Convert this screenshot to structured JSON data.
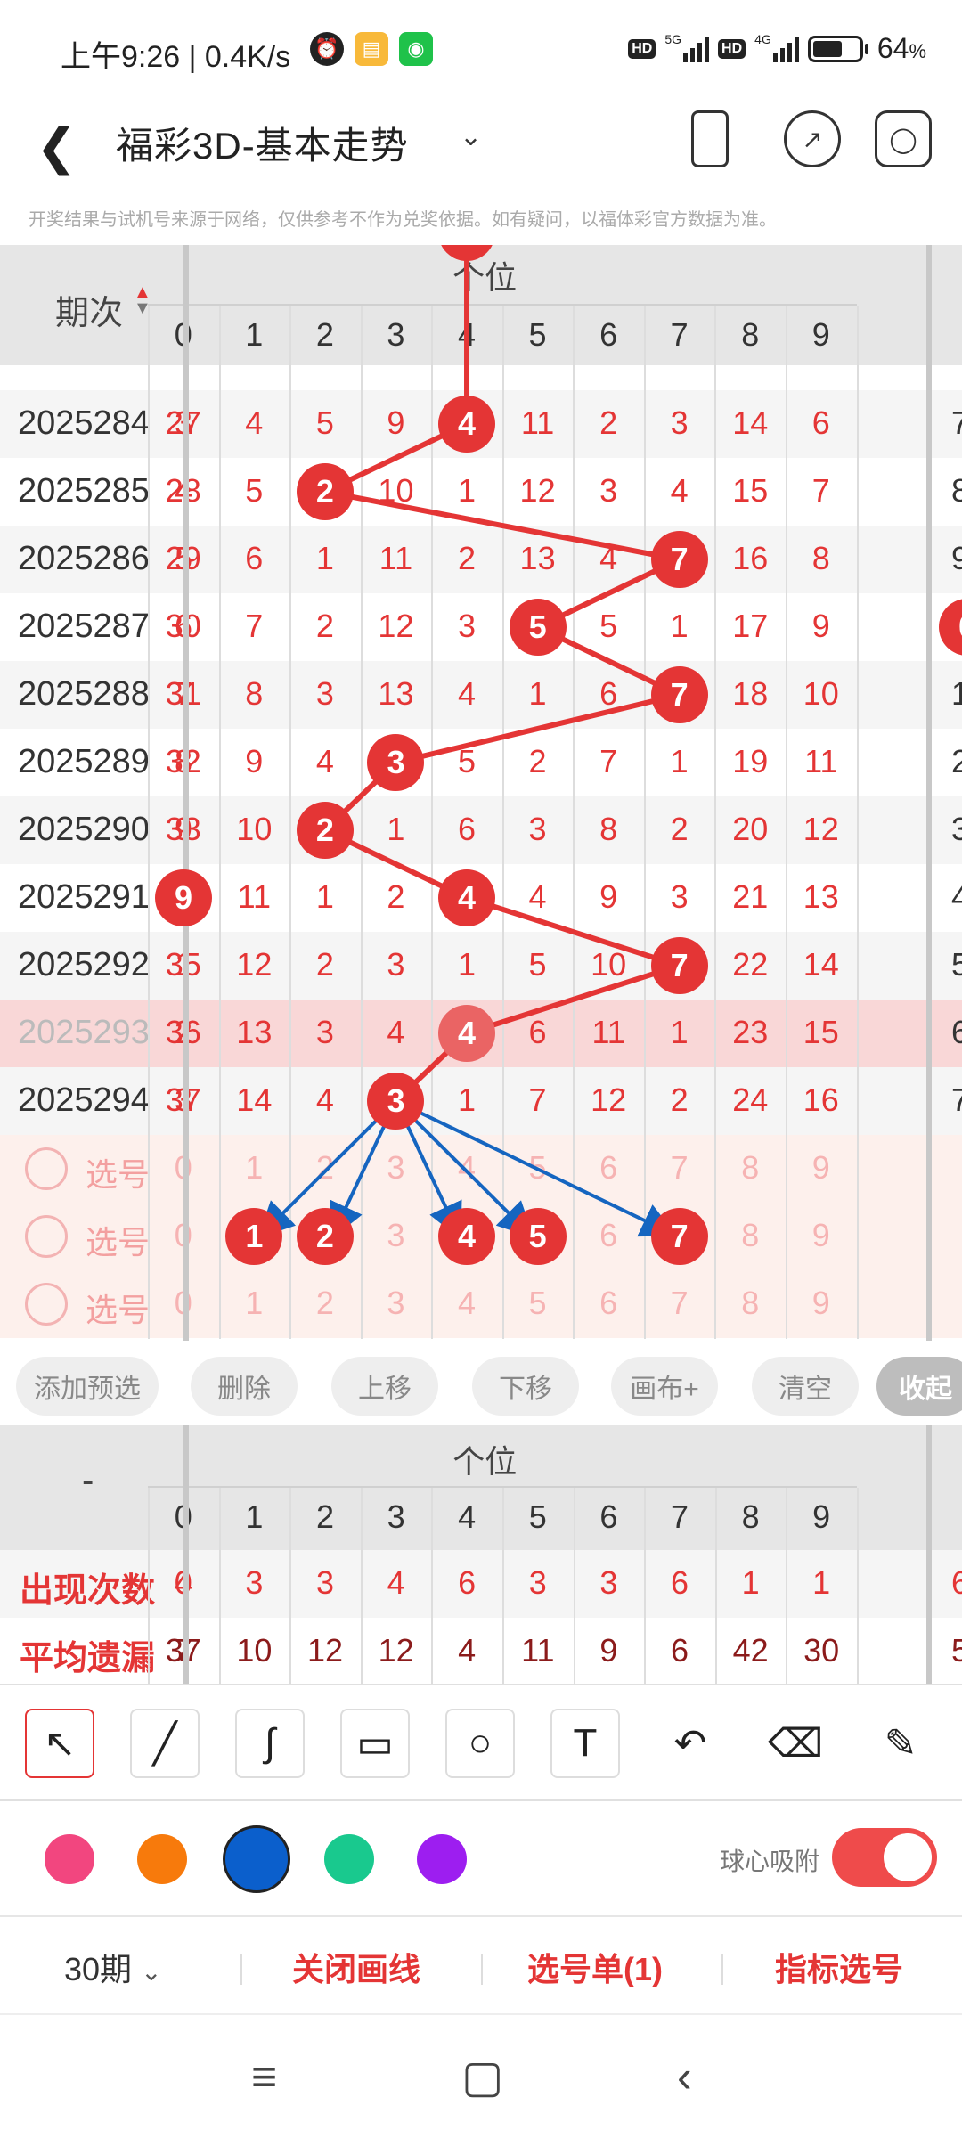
{
  "status": {
    "time": "上午9:26 | 0.4K/s",
    "battery": "64",
    "percent_sign": "%",
    "net1": "5G",
    "net2": "4G",
    "hd": "HD"
  },
  "header": {
    "title": "福彩3D-基本走势",
    "notice": "开奖结果与试机号来源于网络，仅供参考不作为兑奖依据。如有疑问，以福体彩官方数据为准。"
  },
  "table": {
    "period_header": "期次",
    "group_header": "个位",
    "columns": [
      "0",
      "1",
      "2",
      "3",
      "4",
      "5",
      "6",
      "7",
      "8",
      "9"
    ],
    "rows": [
      {
        "period": "2025284",
        "left": "3",
        "cells": [
          "27",
          "4",
          "5",
          "9",
          "4",
          "11",
          "2",
          "3",
          "14",
          "6"
        ],
        "ball": 4,
        "right": "7"
      },
      {
        "period": "2025285",
        "left": "4",
        "cells": [
          "28",
          "5",
          "2",
          "10",
          "1",
          "12",
          "3",
          "4",
          "15",
          "7"
        ],
        "ball": 2,
        "right": "8"
      },
      {
        "period": "2025286",
        "left": "5",
        "cells": [
          "29",
          "6",
          "1",
          "11",
          "2",
          "13",
          "4",
          "7",
          "16",
          "8"
        ],
        "ball": 7,
        "right": "9"
      },
      {
        "period": "2025287",
        "left": "6",
        "cells": [
          "30",
          "7",
          "2",
          "12",
          "3",
          "5",
          "5",
          "1",
          "17",
          "9"
        ],
        "ball": 5,
        "right": "0"
      },
      {
        "period": "2025288",
        "left": "7",
        "cells": [
          "31",
          "8",
          "3",
          "13",
          "4",
          "1",
          "6",
          "7",
          "18",
          "10"
        ],
        "ball": 7,
        "right": "1"
      },
      {
        "period": "2025289",
        "left": "8",
        "cells": [
          "32",
          "9",
          "4",
          "3",
          "5",
          "2",
          "7",
          "1",
          "19",
          "11"
        ],
        "ball": 3,
        "right": "2"
      },
      {
        "period": "2025290",
        "left": "9",
        "cells": [
          "33",
          "10",
          "2",
          "1",
          "6",
          "3",
          "8",
          "2",
          "20",
          "12"
        ],
        "ball": 2,
        "right": "3"
      },
      {
        "period": "2025291",
        "left": "9",
        "cells": [
          "34",
          "11",
          "1",
          "2",
          "4",
          "4",
          "9",
          "3",
          "21",
          "13"
        ],
        "ball": 4,
        "right": "4"
      },
      {
        "period": "2025292",
        "left": "1",
        "cells": [
          "35",
          "12",
          "2",
          "3",
          "1",
          "5",
          "10",
          "7",
          "22",
          "14"
        ],
        "ball": 7,
        "right": "5"
      },
      {
        "period": "2025293",
        "left": "2",
        "cells": [
          "36",
          "13",
          "3",
          "4",
          "4",
          "6",
          "11",
          "1",
          "23",
          "15"
        ],
        "ball": 4,
        "right": "6"
      },
      {
        "period": "2025294",
        "left": "3",
        "cells": [
          "37",
          "14",
          "4",
          "3",
          "1",
          "7",
          "12",
          "2",
          "24",
          "16"
        ],
        "ball": 3,
        "right": "7"
      }
    ],
    "pick_label": "选号",
    "pick_rows": [
      {
        "cells": [
          "0",
          "1",
          "2",
          "3",
          "4",
          "5",
          "6",
          "7",
          "8",
          "9"
        ],
        "selected": []
      },
      {
        "cells": [
          "0",
          "1",
          "2",
          "3",
          "4",
          "5",
          "6",
          "7",
          "8",
          "9"
        ],
        "selected": [
          1,
          2,
          4,
          5,
          7
        ]
      },
      {
        "cells": [
          "0",
          "1",
          "2",
          "3",
          "4",
          "5",
          "6",
          "7",
          "8",
          "9"
        ],
        "selected": []
      }
    ]
  },
  "actions": [
    "添加预选",
    "删除",
    "上移",
    "下移",
    "画布+",
    "清空",
    "收起"
  ],
  "stats": {
    "corner": "-",
    "group_header": "个位",
    "columns": [
      "0",
      "1",
      "2",
      "3",
      "4",
      "5",
      "6",
      "7",
      "8",
      "9"
    ],
    "rows": [
      {
        "label": "出现次数",
        "left": "4",
        "values": [
          "0",
          "3",
          "3",
          "4",
          "6",
          "3",
          "3",
          "6",
          "1",
          "1"
        ],
        "right": "6"
      },
      {
        "label": "平均遗漏",
        "left": "7",
        "values": [
          "37",
          "10",
          "12",
          "12",
          "4",
          "11",
          "9",
          "6",
          "42",
          "30"
        ],
        "right": "5"
      }
    ]
  },
  "tools": [
    "arrow-tool",
    "line-tool",
    "curve-tool",
    "rectangle-tool",
    "circle-tool",
    "text-tool",
    "undo-tool",
    "eraser-tool",
    "clear-tool"
  ],
  "colors": {
    "swatches": [
      "#f2467f",
      "#f77a0c",
      "#0b5fcc",
      "#19c98e",
      "#9d1ef0"
    ],
    "selected_index": 2,
    "snap_label": "球心吸附",
    "snap_on": true
  },
  "bottom": {
    "periods": "30期",
    "close_lines": "关闭画线",
    "pick_list": "选号单(1)",
    "indicator_pick": "指标选号"
  }
}
